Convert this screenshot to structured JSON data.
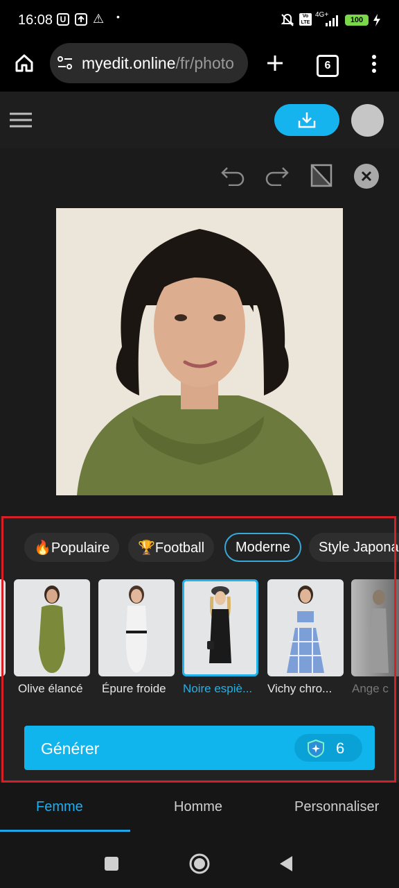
{
  "status_bar": {
    "time": "16:08",
    "icon_u": "U",
    "network": "4G+",
    "battery": "100"
  },
  "browser": {
    "url_domain": "myedit.online",
    "url_path": "/fr/photo",
    "tab_count": "6"
  },
  "categories": [
    {
      "label": "🔥Populaire",
      "active": false
    },
    {
      "label": "🏆Football",
      "active": false
    },
    {
      "label": "Moderne",
      "active": true
    },
    {
      "label": "Style Japonais",
      "active": false
    }
  ],
  "styles": [
    {
      "label": "Olive élancé",
      "dress_color": "#7b8a3a"
    },
    {
      "label": "Épure froide",
      "dress_color": "#f2f2f2"
    },
    {
      "label": "Noire espiè...",
      "dress_color": "#1a1a1a",
      "selected": true
    },
    {
      "label": "Vichy chro...",
      "dress_color": "#7d9fd8"
    },
    {
      "label": "Ange c",
      "dress_color": "#9a9a9a"
    }
  ],
  "generate": {
    "label": "Générer",
    "credits": "6"
  },
  "bottom_tabs": [
    {
      "label": "Femme",
      "active": true
    },
    {
      "label": "Homme",
      "active": false
    },
    {
      "label": "Personnaliser",
      "active": false
    }
  ],
  "colors": {
    "accent": "#15b4ee",
    "highlight": "#d71f28"
  }
}
